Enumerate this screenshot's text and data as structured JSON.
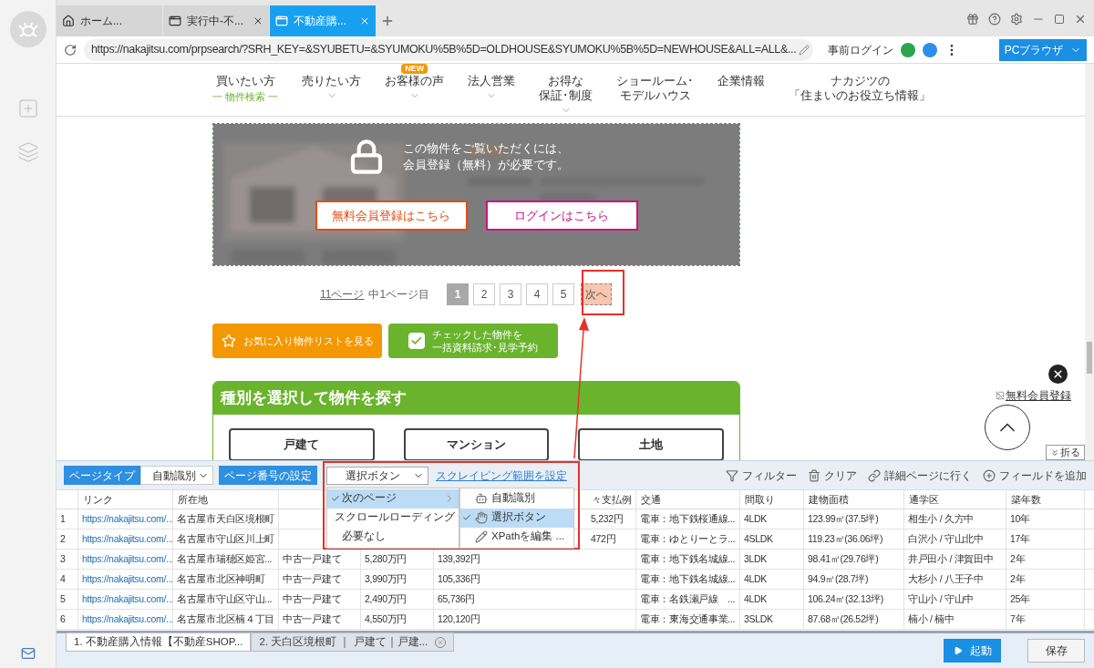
{
  "browser_tabs": [
    {
      "kind": "home",
      "label": "ホーム...",
      "selected": false,
      "closable": false
    },
    {
      "kind": "page",
      "label": "実行中-不...",
      "selected": false,
      "closable": true
    },
    {
      "kind": "page",
      "label": "不動産購...",
      "selected": true,
      "closable": true
    }
  ],
  "address_bar": {
    "url": "https://nakajitsu.com/prpsearch/?SRH_KEY=&SYUBETU=&SYUMOKU%5B%5D=OLDHOUSE&SYUMOKU%5B%5D=NEWHOUSE&ALL=ALL&...",
    "login_label": "事前ログイン",
    "mode_button": "PCブラウザ"
  },
  "site_nav": [
    {
      "lines": [
        "買いたい方"
      ],
      "sub": "一 物件検索 一",
      "dropdown": false
    },
    {
      "lines": [
        "売りたい方"
      ],
      "dropdown": true
    },
    {
      "lines": [
        "お客様の声"
      ],
      "badge": "NEW",
      "dropdown": true
    },
    {
      "lines": [
        "法人営業"
      ],
      "dropdown": true
    },
    {
      "lines": [
        "お得な",
        "保証･制度"
      ],
      "dropdown": true
    },
    {
      "lines": [
        "ショールーム･",
        "モデルハウス"
      ],
      "dropdown": false
    },
    {
      "lines": [
        "企業情報"
      ],
      "dropdown": false
    },
    {
      "lines": [
        "ナカジツの",
        "「住まいのお役立ち情報」"
      ],
      "dropdown": false
    }
  ],
  "lock_notice": {
    "message_lines": [
      "この物件をご覧いただくには、",
      "会員登録（無料）が必要です。"
    ],
    "buttons": [
      {
        "kind": "register",
        "label": "無料会員登録はこちら"
      },
      {
        "kind": "login",
        "label": "ログインはこちら"
      }
    ]
  },
  "pagination": {
    "summary_link": "11ページ",
    "summary_text": "中1ページ目",
    "pages": [
      {
        "label": "1",
        "selected": true
      },
      {
        "label": "2",
        "selected": false
      },
      {
        "label": "3",
        "selected": false
      },
      {
        "label": "4",
        "selected": false
      },
      {
        "label": "5",
        "selected": false
      }
    ],
    "next": "次へ"
  },
  "action_buttons": [
    {
      "kind": "favorite",
      "lines": [
        "お気に入り物件リストを見る"
      ]
    },
    {
      "kind": "check",
      "lines": [
        "チェックした物件を",
        "一括資料請求･見学予約"
      ]
    }
  ],
  "category_search": {
    "title": "種別を選択して物件を探す",
    "options": [
      "戸建て",
      "マンション",
      "土地"
    ]
  },
  "floating": {
    "banner_alt": "無料会員登録",
    "fold_label": "折る"
  },
  "toolbar": {
    "page_type_label": "ページタイプ",
    "page_type_value": "自動識別",
    "page_number_label": "ページ番号の設定",
    "page_number_value": "選択ボタン",
    "range_link": "スクレイピング範囲を設定",
    "tools": [
      {
        "kind": "filter",
        "label": "フィルター"
      },
      {
        "kind": "clear",
        "label": "クリア"
      },
      {
        "kind": "link",
        "label": "詳細ページに行く"
      },
      {
        "kind": "add",
        "label": "フィールドを追加"
      }
    ]
  },
  "dropdown": {
    "items": [
      {
        "label": "次のページ",
        "selected": true,
        "submenu": true
      },
      {
        "label": "スクロールローディング",
        "selected": false,
        "submenu": false
      },
      {
        "label": "必要なし",
        "selected": false,
        "submenu": false
      }
    ],
    "submenu": [
      {
        "kind": "robot",
        "label": "自動識別",
        "selected": false
      },
      {
        "kind": "pointer",
        "label": "選択ボタン",
        "selected": true
      },
      {
        "kind": "edit",
        "label": "XPathを編集 ...",
        "selected": false
      }
    ]
  },
  "table": {
    "columns": [
      null,
      "リンク",
      "所在地",
      null,
      null,
      "々支払例",
      "交通",
      "間取り",
      "建物面積",
      "通学区",
      "築年数"
    ],
    "rows": [
      [
        "1",
        "https://nakajitsu.com/...",
        "名古屋市天白区境根町",
        null,
        null,
        "5,232円",
        "電車：地下鉄桜通線...",
        "4LDK",
        "123.99㎡(37.5坪)",
        "相生小 / 久方中",
        "10年"
      ],
      [
        "2",
        "https://nakajitsu.com/...",
        "名古屋市守山区川上町",
        null,
        null,
        "472円",
        "電車：ゆとりーとラ...",
        "4SLDK",
        "119.23㎡(36.06坪)",
        "白沢小 / 守山北中",
        "17年"
      ],
      [
        "3",
        "https://nakajitsu.com/...",
        "名古屋市瑞穂区姫宮...",
        "中古一戸建て",
        "5,280万円",
        "139,392円",
        "電車：地下鉄名城線...",
        "3LDK",
        "98.41㎡(29.76坪)",
        "井戸田小 / 津賀田中",
        "2年"
      ],
      [
        "4",
        "https://nakajitsu.com/...",
        "名古屋市北区神明町",
        "中古一戸建て",
        "3,990万円",
        "105,336円",
        "電車：地下鉄名城線...",
        "4LDK",
        "94.9㎡(28.7坪)",
        "大杉小 / 八王子中",
        "2年"
      ],
      [
        "5",
        "https://nakajitsu.com/...",
        "名古屋市守山区守山...",
        "中古一戸建て",
        "2,490万円",
        "65,736円",
        "電車：名鉄瀬戸線　...",
        "4LDK",
        "106.24㎡(32.13坪)",
        "守山小 / 守山中",
        "25年"
      ],
      [
        "6",
        "https://nakajitsu.com/...",
        "名古屋市北区楠４丁目",
        "中古一戸建て",
        "4,550万円",
        "120,120円",
        "電車：東海交通事業...",
        "3SLDK",
        "87.68㎡(26.52坪)",
        "楠小 / 楠中",
        "7年"
      ]
    ]
  },
  "task_tabs": [
    {
      "label": "1. 不動産購入情報【不動産SHOP...",
      "selected": true,
      "closable": false
    },
    {
      "label": "2. 天白区境根町 ｜ 戸建て｜戸建...",
      "selected": false,
      "closable": true
    }
  ],
  "run_button": "起動",
  "save_button": "保存"
}
